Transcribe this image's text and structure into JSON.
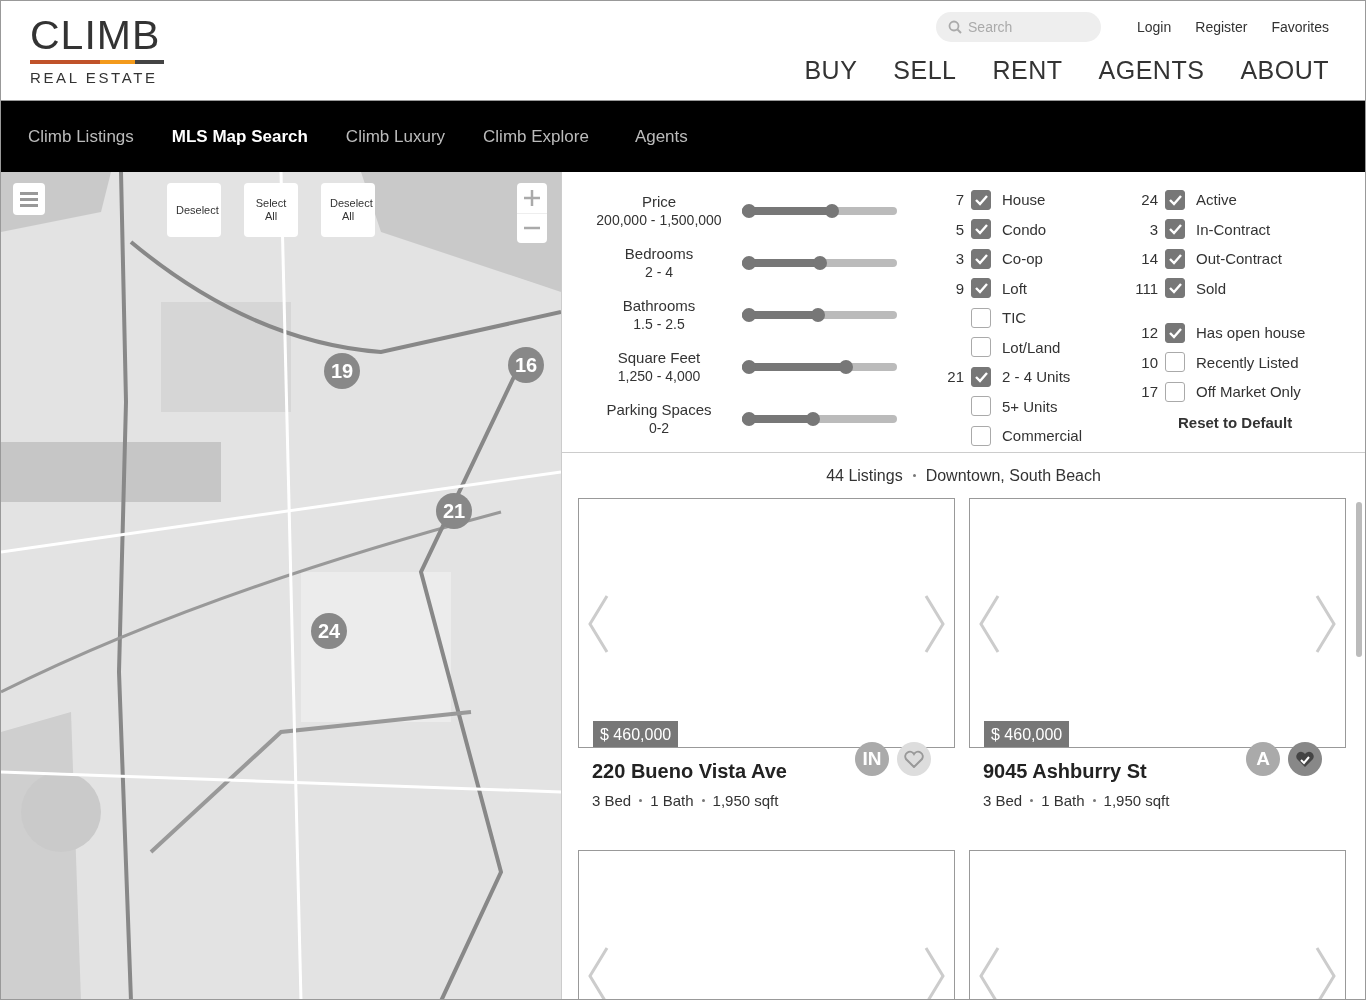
{
  "logo": {
    "name": "CLIMB",
    "tagline": "REAL ESTATE"
  },
  "search": {
    "placeholder": "Search"
  },
  "account_links": [
    "Login",
    "Register",
    "Favorites"
  ],
  "main_nav": [
    "BUY",
    "SELL",
    "RENT",
    "AGENTS",
    "ABOUT"
  ],
  "sub_nav": [
    {
      "label": "Climb Listings",
      "selected": false
    },
    {
      "label": "MLS Map Search",
      "selected": true
    },
    {
      "label": "Climb Luxury",
      "selected": false
    },
    {
      "label": "Climb Explore",
      "selected": false
    },
    {
      "label": "Agents",
      "selected": false
    }
  ],
  "map": {
    "kind": "picture",
    "buttons": [
      "Deselect",
      "Select All",
      "Deselect All"
    ],
    "clusters": [
      "19",
      "16",
      "21",
      "24"
    ]
  },
  "sliders": [
    {
      "label": "Price",
      "range": "200,000 - 1,500,000",
      "level": 0.58
    },
    {
      "label": "Bedrooms",
      "range": "2 - 4",
      "level": 0.5
    },
    {
      "label": "Bathrooms",
      "range": "1.5 - 2.5",
      "level": 0.49
    },
    {
      "label": "Square Feet",
      "range": "1,250 - 4,000",
      "level": 0.67
    },
    {
      "label": "Parking Spaces",
      "range": "0-2",
      "level": 0.46
    }
  ],
  "property_types": [
    {
      "count": "7",
      "label": "House",
      "checked": true
    },
    {
      "count": "5",
      "label": "Condo",
      "checked": true
    },
    {
      "count": "3",
      "label": "Co-op",
      "checked": true
    },
    {
      "count": "9",
      "label": "Loft",
      "checked": true
    },
    {
      "label": "TIC",
      "checked": false
    },
    {
      "label": "Lot/Land",
      "checked": false
    },
    {
      "count": "21",
      "label": "2 - 4 Units",
      "checked": true
    },
    {
      "label": "5+ Units",
      "checked": false
    },
    {
      "label": "Commercial",
      "checked": false
    }
  ],
  "statuses": [
    {
      "count": "24",
      "label": "Active",
      "checked": true
    },
    {
      "count": "3",
      "label": "In-Contract",
      "checked": true
    },
    {
      "count": "14",
      "label": "Out-Contract",
      "checked": true
    },
    {
      "count": "111",
      "label": "Sold",
      "checked": true
    }
  ],
  "extras": [
    {
      "count": "12",
      "label": "Has open house",
      "checked": true
    },
    {
      "count": "10",
      "label": "Recently Listed",
      "checked": false
    },
    {
      "count": "17",
      "label": "Off Market Only",
      "checked": false
    }
  ],
  "reset_button": "Reset to Default",
  "summary": {
    "count": "44 Listings",
    "area": "Downtown, South Beach"
  },
  "cards": [
    {
      "kind": "listing",
      "price": "$ 460,000",
      "address": "220 Bueno Vista Ave",
      "beds": "3 Bed",
      "baths": "1 Bath",
      "sqft": "1,950 sqft",
      "status": "IN",
      "favorite": false
    },
    {
      "kind": "listing",
      "price": "$ 460,000",
      "address": "9045 Ashburry St",
      "beds": "3 Bed",
      "baths": "1 Bath",
      "sqft": "1,950 sqft",
      "status": "A",
      "favorite": true
    },
    {
      "kind": "frame"
    },
    {
      "kind": "frame"
    }
  ]
}
